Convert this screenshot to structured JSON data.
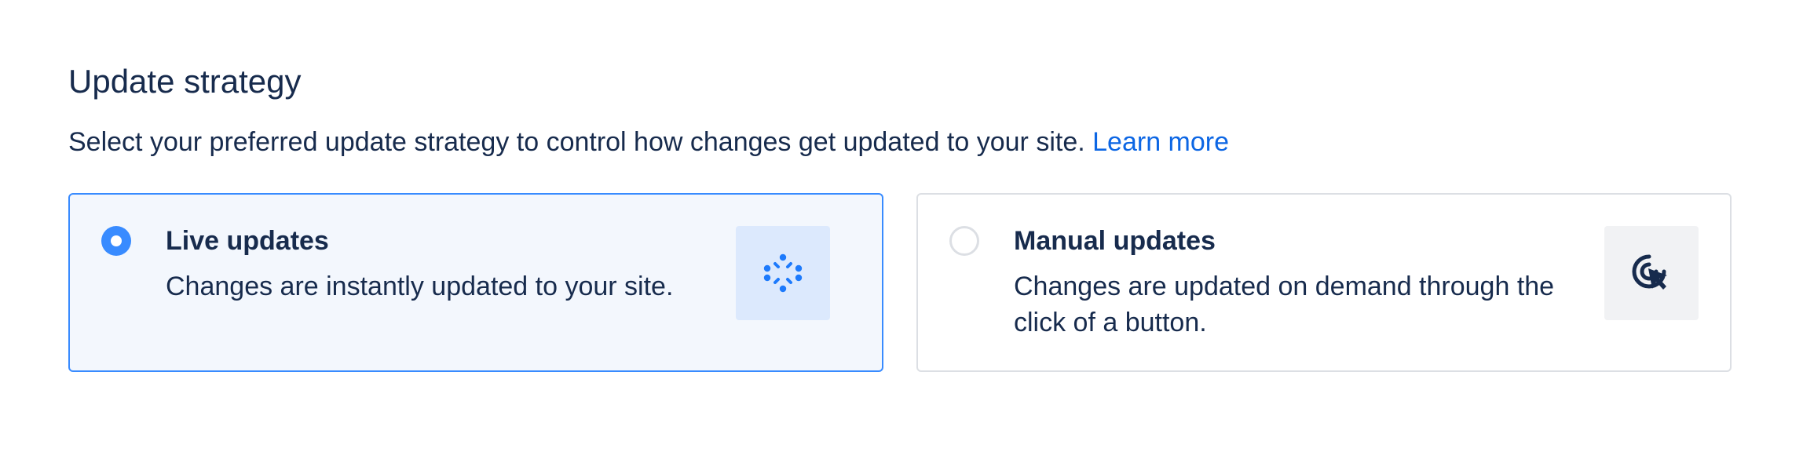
{
  "section": {
    "title": "Update strategy",
    "description": "Select your preferred update strategy to control how changes get updated to your site.",
    "learn_more": "Learn more"
  },
  "options": [
    {
      "title": "Live updates",
      "description": "Changes are instantly updated to your site.",
      "selected": true,
      "icon": "live-sync-icon"
    },
    {
      "title": "Manual updates",
      "description": "Changes are updated on demand through the click of a button.",
      "selected": false,
      "icon": "cursor-click-icon"
    }
  ],
  "colors": {
    "accent": "#388bff",
    "link": "#0c66e4",
    "text": "#172b4d",
    "selected_bg": "#f3f7fd",
    "border": "#dcdfe4"
  }
}
